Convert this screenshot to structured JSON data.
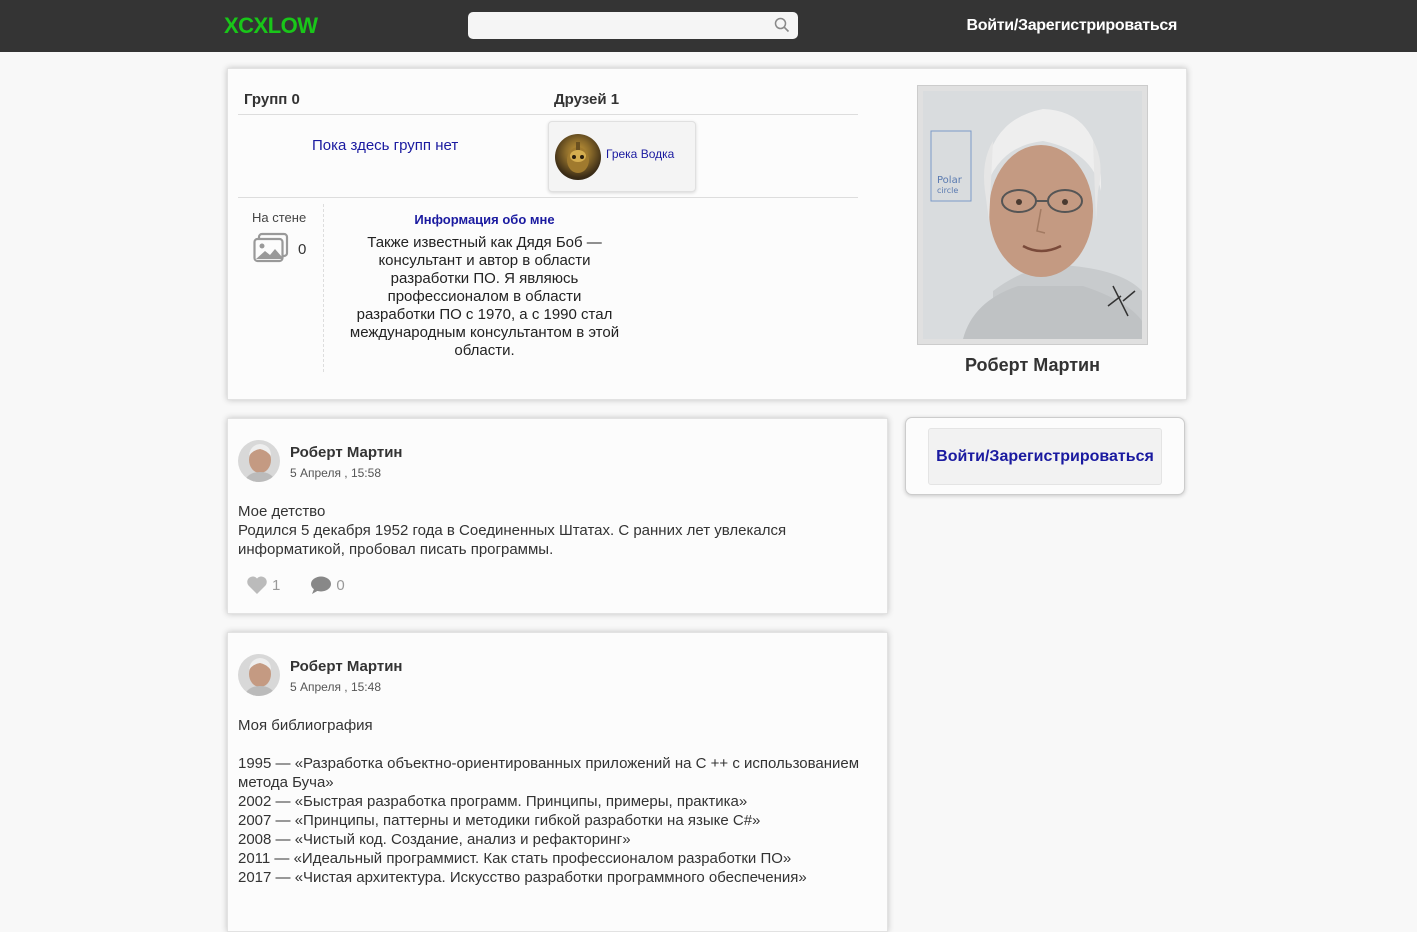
{
  "header": {
    "logo": "XCXLOW",
    "search_placeholder": "",
    "login_label": "Войти/Зарегистрироваться"
  },
  "profile": {
    "groups_label": "Групп 0",
    "friends_label": "Друзей 1",
    "no_groups_text": "Пока здесь групп нет",
    "friend": {
      "name": "Грека Водка"
    },
    "wall_label": "На стене",
    "wall_count": "0",
    "about_title": "Информация обо мне",
    "about_text": "Также известный как Дядя Боб — консультант и автор в области разработки ПО. Я являюсь профессионалом в области разработки ПО с 1970, а с 1990 стал международным консультантом в этой области.",
    "name": "Роберт Мартин"
  },
  "sidebar": {
    "login_label": "Войти/Зарегистрироваться"
  },
  "posts": [
    {
      "author": "Роберт Мартин",
      "date": "5 Апреля , 15:58",
      "body": "Мое детство\nРодился 5 декабря 1952 года в Соединенных Штатах. С ранних лет увлекался информатикой, пробовал писать программы.",
      "likes": "1",
      "comments": "0"
    },
    {
      "author": "Роберт Мартин",
      "date": "5 Апреля , 15:48",
      "body": "Моя библиография\n\n1995 — «Разработка объектно-ориентированных приложений на C ++ с использованием метода Буча»\n2002 — «Быстрая разработка программ. Принципы, примеры, практика»\n2007 — «Принципы, паттерны и методики гибкой разработки на языке C#»\n2008 — «Чистый код. Создание, анализ и рефакторинг»\n2011 — «Идеальный программист. Как стать профессионалом разработки ПО»\n2017 — «Чистая архитектура. Искусство разработки программного обеспечения»"
    }
  ],
  "colors": {
    "header_bg": "#343434",
    "logo": "#19c619",
    "link": "#1a1aa0",
    "page_bg": "#f8f8f8"
  },
  "icons": [
    "search-icon",
    "image-gallery-icon",
    "heart-icon",
    "comment-icon"
  ]
}
